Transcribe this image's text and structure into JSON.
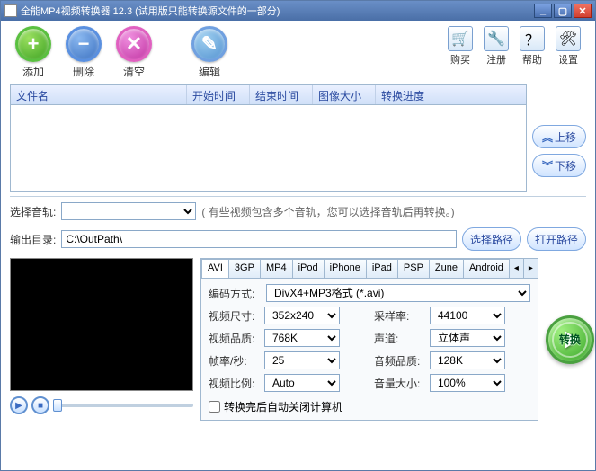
{
  "title": "全能MP4视频转换器 12.3 (试用版只能转换源文件的一部分)",
  "toolbar": {
    "add": "添加",
    "del": "删除",
    "clr": "清空",
    "edit": "编辑",
    "buy": "购买",
    "reg": "注册",
    "help": "帮助",
    "set": "设置"
  },
  "table": {
    "file": "文件名",
    "start": "开始时间",
    "end": "结束时间",
    "size": "图像大小",
    "prog": "转换进度"
  },
  "side": {
    "up": "上移",
    "down": "下移"
  },
  "audio": {
    "label": "选择音轨:",
    "note": "( 有些视频包含多个音轨，您可以选择音轨后再转换。)"
  },
  "out": {
    "label": "输出目录:",
    "path": "C:\\OutPath\\",
    "choose": "选择路径",
    "open": "打开路径"
  },
  "tabs": [
    "AVI",
    "3GP",
    "MP4",
    "iPod",
    "iPhone",
    "iPad",
    "PSP",
    "Zune",
    "Android"
  ],
  "fmt": {
    "label": "编码方式:",
    "value": "DivX4+MP3格式 (*.avi)"
  },
  "vsize": {
    "label": "视频尺寸:",
    "value": "352x240"
  },
  "srate": {
    "label": "采样率:",
    "value": "44100"
  },
  "vq": {
    "label": "视频品质:",
    "value": "768K"
  },
  "ch": {
    "label": "声道:",
    "value": "立体声"
  },
  "fps": {
    "label": "帧率/秒:",
    "value": "25"
  },
  "aq": {
    "label": "音频品质:",
    "value": "128K"
  },
  "ratio": {
    "label": "视频比例:",
    "value": "Auto"
  },
  "vol": {
    "label": "音量大小:",
    "value": "100%"
  },
  "shutdown": "转换完后自动关闭计算机",
  "convert": "转换"
}
